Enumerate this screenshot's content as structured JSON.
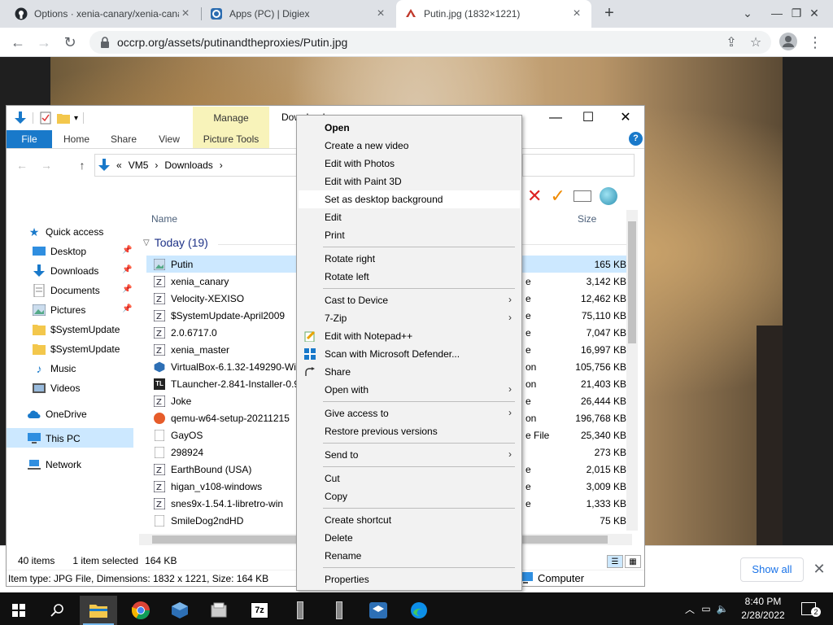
{
  "browser": {
    "tabs": [
      {
        "title": "Options · xenia-canary/xenia-canary",
        "active": false
      },
      {
        "title": "Apps (PC) | Digiex",
        "active": false
      },
      {
        "title": "Putin.jpg (1832×1221)",
        "active": true
      }
    ],
    "url": "occrp.org/assets/putinandtheproxies/Putin.jpg",
    "show_all_label": "Show all"
  },
  "explorer": {
    "title": "Downloads",
    "manage_label": "Manage",
    "ribbon_tabs": [
      "File",
      "Home",
      "Share",
      "View",
      "Picture Tools"
    ],
    "breadcrumb": [
      "«",
      "VM5",
      "›",
      "Downloads",
      "›"
    ],
    "nav": {
      "quick_access": "Quick access",
      "items": [
        {
          "label": "Desktop",
          "pinned": true
        },
        {
          "label": "Downloads",
          "pinned": true
        },
        {
          "label": "Documents",
          "pinned": true
        },
        {
          "label": "Pictures",
          "pinned": true
        },
        {
          "label": "$SystemUpdate",
          "pinned": false
        },
        {
          "label": "$SystemUpdate",
          "pinned": false
        },
        {
          "label": "Music",
          "pinned": false
        },
        {
          "label": "Videos",
          "pinned": false
        }
      ],
      "onedrive": "OneDrive",
      "this_pc": "This PC",
      "network": "Network"
    },
    "columns": {
      "name": "Name",
      "size": "Size"
    },
    "group": "Today (19)",
    "files": [
      {
        "name": "Putin",
        "type": "",
        "size": "165 KB"
      },
      {
        "name": "xenia_canary",
        "type": "e",
        "size": "3,142 KB"
      },
      {
        "name": "Velocity-XEXISO",
        "type": "e",
        "size": "12,462 KB"
      },
      {
        "name": "$SystemUpdate-April2009",
        "type": "e",
        "size": "75,110 KB"
      },
      {
        "name": "2.0.6717.0",
        "type": "e",
        "size": "7,047 KB"
      },
      {
        "name": "xenia_master",
        "type": "e",
        "size": "16,997 KB"
      },
      {
        "name": "VirtualBox-6.1.32-149290-Win",
        "type": "on",
        "size": "105,756 KB"
      },
      {
        "name": "TLauncher-2.841-Installer-0.9.6",
        "type": "on",
        "size": "21,403 KB"
      },
      {
        "name": "Joke",
        "type": "e",
        "size": "26,444 KB"
      },
      {
        "name": "qemu-w64-setup-20211215",
        "type": "on",
        "size": "196,768 KB"
      },
      {
        "name": "GayOS",
        "type": "e File",
        "size": "25,340 KB"
      },
      {
        "name": "298924",
        "type": "",
        "size": "273 KB"
      },
      {
        "name": "EarthBound (USA)",
        "type": "e",
        "size": "2,015 KB"
      },
      {
        "name": "higan_v108-windows",
        "type": "e",
        "size": "3,009 KB"
      },
      {
        "name": "snes9x-1.54.1-libretro-win",
        "type": "e",
        "size": "1,333 KB"
      },
      {
        "name": "SmileDog2ndHD",
        "type": "",
        "size": "75 KB"
      }
    ],
    "status": {
      "items": "40 items",
      "selected": "1 item selected",
      "size": "164 KB"
    },
    "details": "Item type: JPG File, Dimensions: 1832 x 1221, Size: 164 KB",
    "computer_label": "Computer"
  },
  "context_menu": [
    {
      "label": "Open",
      "bold": true
    },
    {
      "label": "Create a new video"
    },
    {
      "label": "Edit with Photos"
    },
    {
      "label": "Edit with Paint 3D"
    },
    {
      "label": "Set as desktop background",
      "hover": true
    },
    {
      "label": "Edit"
    },
    {
      "label": "Print"
    },
    {
      "sep": true
    },
    {
      "label": "Rotate right"
    },
    {
      "label": "Rotate left"
    },
    {
      "sep": true
    },
    {
      "label": "Cast to Device",
      "submenu": true
    },
    {
      "label": "7-Zip",
      "submenu": true
    },
    {
      "label": "Edit with Notepad++",
      "icon": "notepad-icon"
    },
    {
      "label": "Scan with Microsoft Defender...",
      "icon": "defender-icon"
    },
    {
      "label": "Share",
      "icon": "share-icon"
    },
    {
      "label": "Open with",
      "submenu": true
    },
    {
      "sep": true
    },
    {
      "label": "Give access to",
      "submenu": true
    },
    {
      "label": "Restore previous versions"
    },
    {
      "sep": true
    },
    {
      "label": "Send to",
      "submenu": true
    },
    {
      "sep": true
    },
    {
      "label": "Cut"
    },
    {
      "label": "Copy"
    },
    {
      "sep": true
    },
    {
      "label": "Create shortcut"
    },
    {
      "label": "Delete"
    },
    {
      "label": "Rename"
    },
    {
      "sep": true
    },
    {
      "label": "Properties"
    }
  ],
  "taskbar": {
    "time": "8:40 PM",
    "date": "2/28/2022",
    "notification_count": "2"
  },
  "colors": {
    "accent": "#1979ca",
    "selection": "#cce8ff",
    "manage": "#f8f3ba"
  }
}
